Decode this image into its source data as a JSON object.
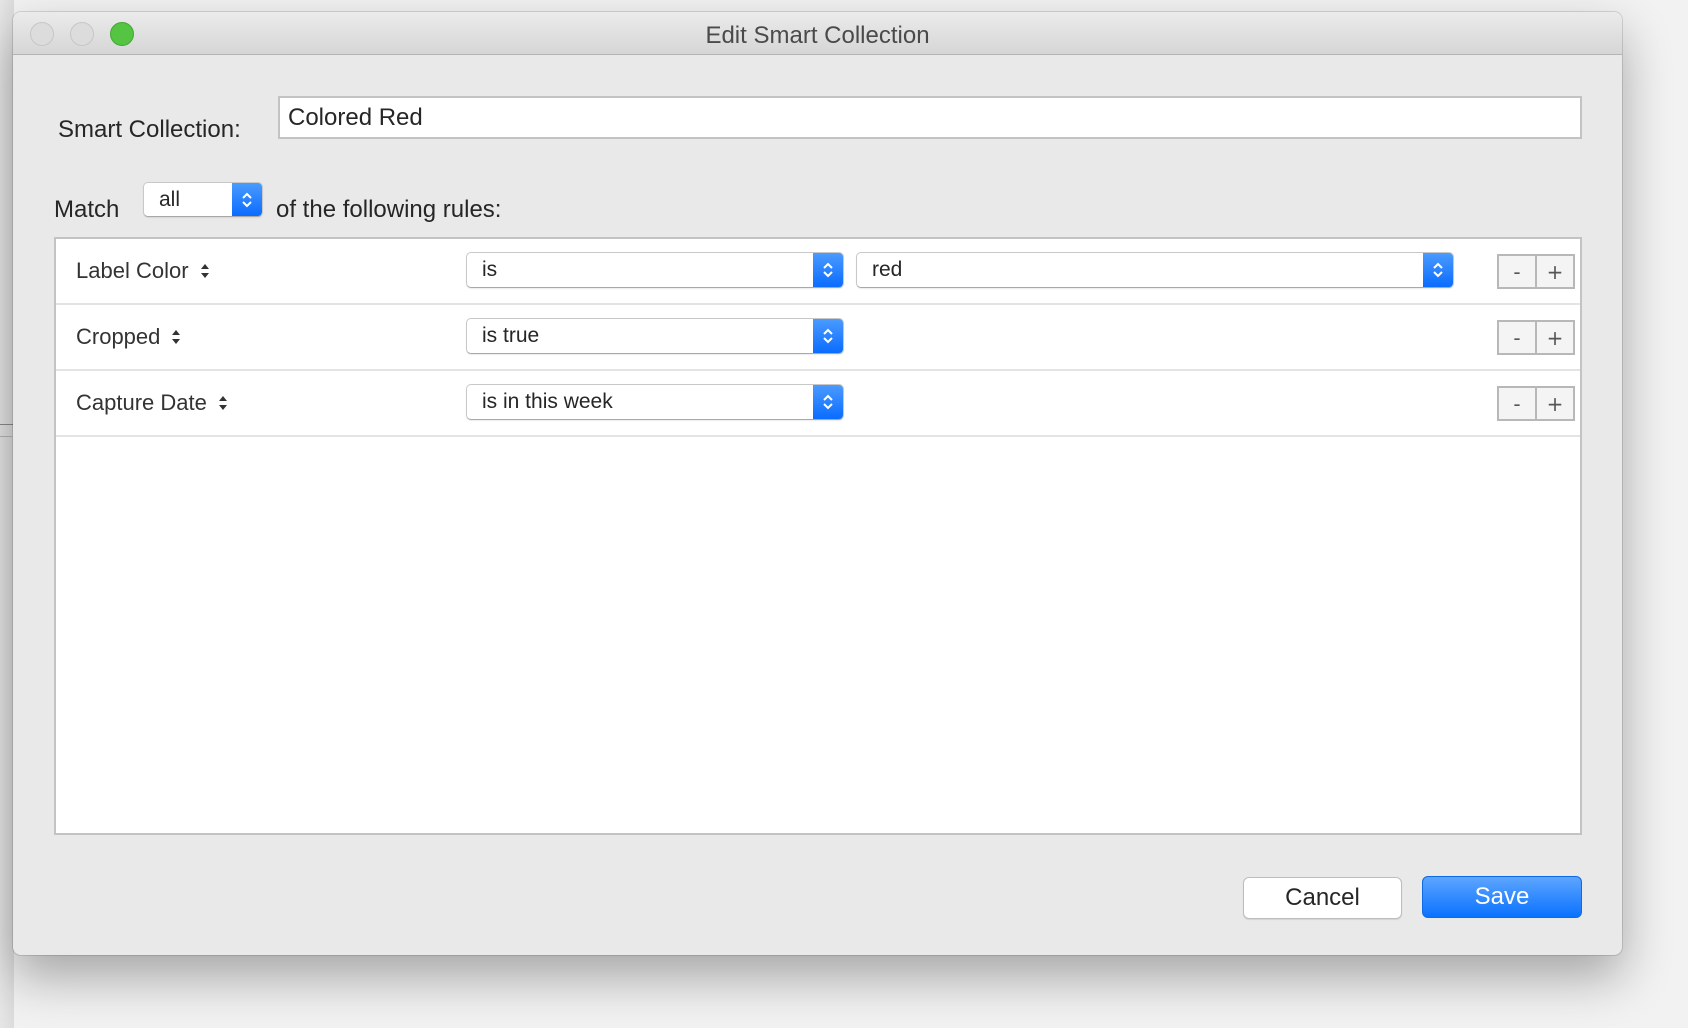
{
  "window": {
    "title": "Edit Smart Collection",
    "traffic_lights": [
      "close",
      "minimize",
      "zoom"
    ]
  },
  "form": {
    "name_label": "Smart Collection:",
    "name_value": "Colored Red",
    "match_label": "Match",
    "match_value": "all",
    "match_suffix": "of the following rules:"
  },
  "rules": [
    {
      "field": "Label Color",
      "operator": "is",
      "value": "red"
    },
    {
      "field": "Cropped",
      "operator": "is true"
    },
    {
      "field": "Capture Date",
      "operator": "is in this week"
    }
  ],
  "stepper": {
    "remove_label": "-",
    "add_label": "+"
  },
  "buttons": {
    "cancel": "Cancel",
    "save": "Save"
  },
  "colors": {
    "accent": "#0a6cff",
    "zoom_button": "#55c442",
    "window_bg": "#e9e9e9"
  }
}
